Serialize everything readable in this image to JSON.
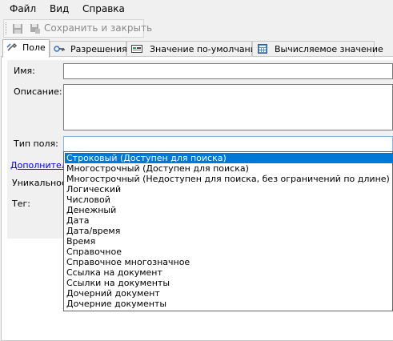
{
  "menu": [
    "Файл",
    "Вид",
    "Справка"
  ],
  "toolbar": {
    "save_and_close": "Сохранить и закрыть"
  },
  "tabs": [
    "Поле",
    "Разрешения",
    "Значение по-умолчанию",
    "Вычисляемое значение"
  ],
  "form": {
    "name_label": "Имя:",
    "description_label": "Описание:",
    "field_type_label": "Тип поля:",
    "additional_link": "Дополнитель",
    "unique_label": "Уникальное",
    "tag_label": "Тег:",
    "field_type_options": [
      "Строковый (Доступен для поиска)",
      "Многострочный (Доступен для поиска)",
      "Многострочный (Недоступен для поиска, без ограничений по длине)",
      "Логический",
      "Числовой",
      "Денежный",
      "Дата",
      "Дата/время",
      "Время",
      "Справочное",
      "Справочное многозначное",
      "Ссылка на документ",
      "Ссылки на документы",
      "Дочерний документ",
      "Дочерние документы"
    ],
    "selected_option_index": 0
  },
  "colors": {
    "selection": "#0078d7",
    "link": "#0000ee",
    "combo_border": "#7eb4ea"
  }
}
